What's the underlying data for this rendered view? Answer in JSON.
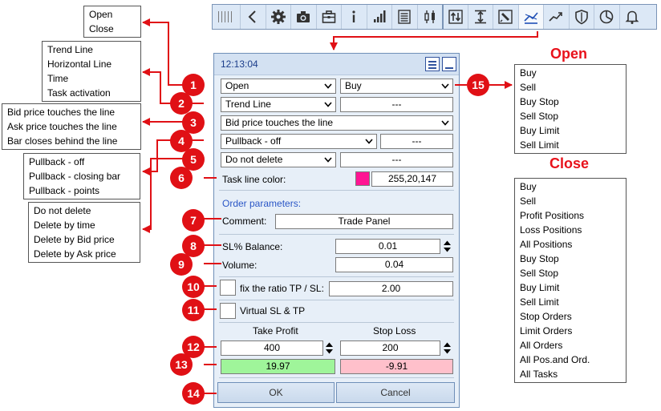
{
  "toolbar": {
    "buttons": [
      "grip-icon",
      "back-icon",
      "gear-icon",
      "camera-icon",
      "briefcase-icon",
      "info-icon",
      "signal-bars-icon",
      "list-icon",
      "candlestick-icon",
      "sort-arrows-icon",
      "level-icon",
      "chart-edit-icon",
      "trend-cross-icon",
      "trend-up-icon",
      "shield-icon",
      "pie-chart-icon",
      "bell-icon"
    ]
  },
  "panel": {
    "clock": "12:13:04",
    "row1": {
      "mode": "Open",
      "order": "Buy"
    },
    "row2": {
      "line_type": "Trend Line",
      "value": "---"
    },
    "row3": {
      "trigger": "Bid price touches the line"
    },
    "row4": {
      "pullback": "Pullback - off",
      "value": "---"
    },
    "row5": {
      "deletion": "Do not delete",
      "value": "---"
    },
    "row6": {
      "label": "Task line color:",
      "color_value": "255,20,147",
      "swatch_color": "#ff1493"
    },
    "order_params_title": "Order parameters:",
    "comment": {
      "label": "Comment:",
      "value": "Trade Panel"
    },
    "sl_balance": {
      "label": "SL% Balance:",
      "value": "0.01"
    },
    "volume": {
      "label": "Volume:",
      "value": "0.04"
    },
    "fix_ratio": {
      "label": "fix the ratio TP / SL:",
      "value": "2.00"
    },
    "virtual": {
      "label": "Virtual SL & TP"
    },
    "take_profit": {
      "label": "Take Profit",
      "value": "400",
      "money": "19.97"
    },
    "stop_loss": {
      "label": "Stop Loss",
      "value": "200",
      "money": "-9.91"
    },
    "ok_label": "OK",
    "cancel_label": "Cancel"
  },
  "callouts": {
    "mode_options": [
      "Open",
      "Close"
    ],
    "line_options": [
      "Trend Line",
      "Horizontal Line",
      "Time",
      "Task activation"
    ],
    "trigger_options": [
      "Bid price touches the line",
      "Ask price touches the line",
      "Bar closes behind the line"
    ],
    "pullback_options": [
      "Pullback - off",
      "Pullback - closing bar",
      "Pullback - points"
    ],
    "delete_options": [
      "Do not delete",
      "Delete by time",
      "Delete by Bid price",
      "Delete by Ask price"
    ],
    "open_heading": "Open",
    "open_options": [
      "Buy",
      "Sell",
      "Buy Stop",
      "Sell Stop",
      "Buy Limit",
      "Sell Limit"
    ],
    "close_heading": "Close",
    "close_options": [
      "Buy",
      "Sell",
      "Profit Positions",
      "Loss Positions",
      "All Positions",
      "Buy Stop",
      "Sell Stop",
      "Buy Limit",
      "Sell Limit",
      "Stop Orders",
      "Limit Orders",
      "All Orders",
      "All Pos.and Ord.",
      "All Tasks"
    ]
  },
  "markers": [
    "1",
    "2",
    "3",
    "4",
    "5",
    "6",
    "7",
    "8",
    "9",
    "10",
    "11",
    "12",
    "13",
    "14",
    "15"
  ],
  "colors": {
    "marker_red": "#e01015",
    "tp_green": "#9ff59a",
    "sl_pink": "#ffc0cb",
    "clock_blue": "#1b3d8a",
    "order_params_blue": "#2a56c6"
  }
}
